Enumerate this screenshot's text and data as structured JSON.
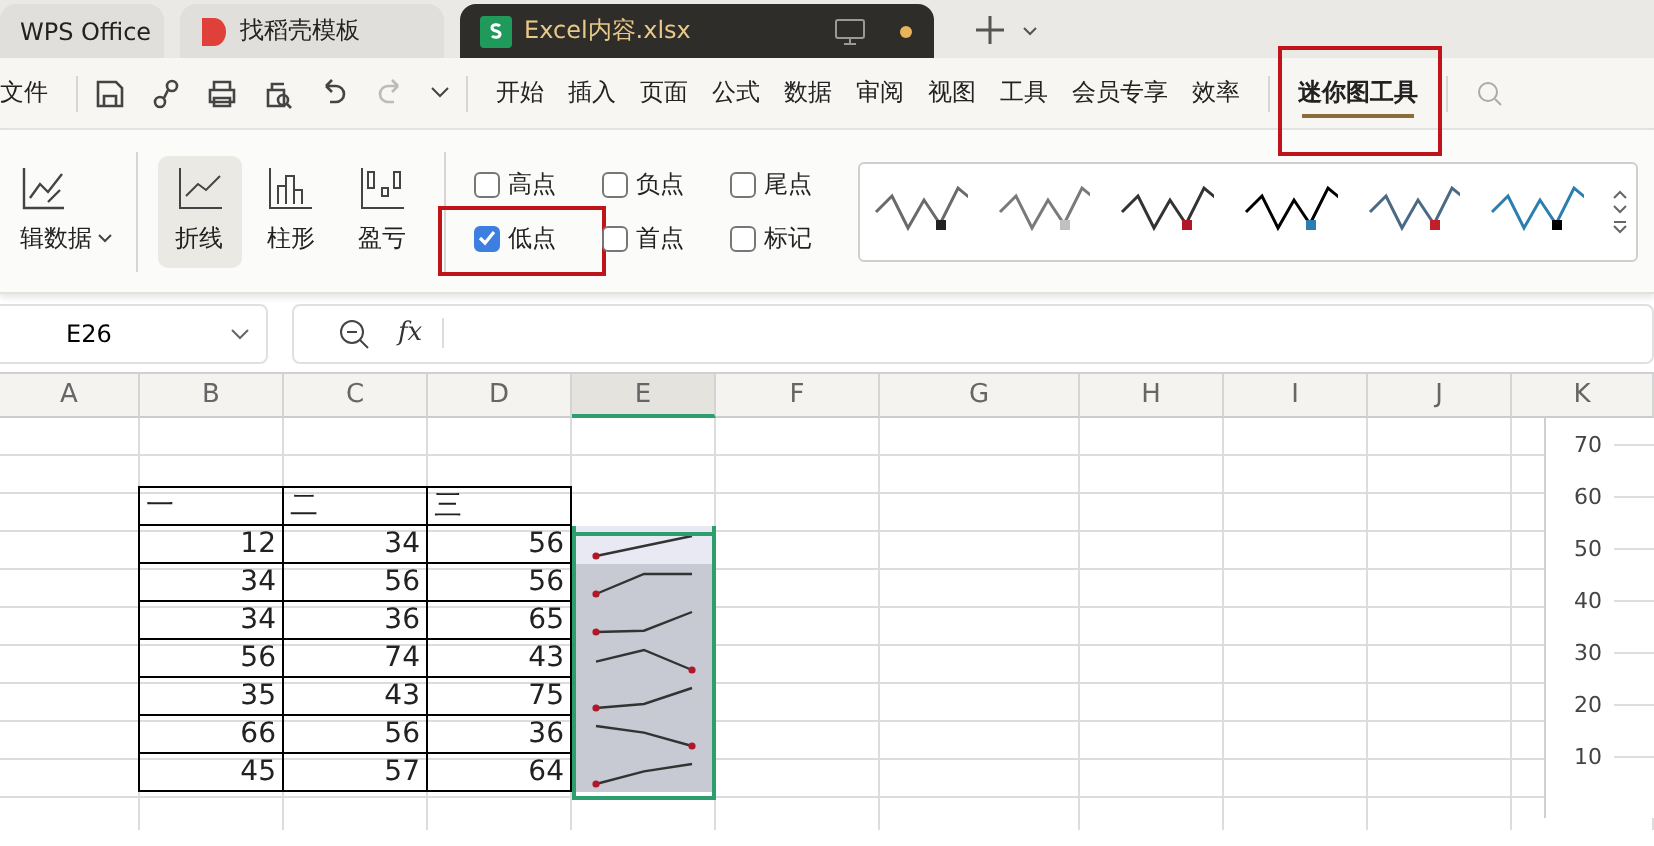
{
  "tabs": [
    {
      "label": "WPS Office",
      "kind": "home",
      "selected": false
    },
    {
      "label": "找稻壳模板",
      "kind": "docer",
      "selected": false
    },
    {
      "label": "Excel内容.xlsx",
      "kind": "sheet",
      "selected": true
    }
  ],
  "menu": {
    "file": "文件",
    "items": [
      {
        "label": "开始",
        "selected": false,
        "highlighted": false
      },
      {
        "label": "插入",
        "selected": false,
        "highlighted": false
      },
      {
        "label": "页面",
        "selected": false,
        "highlighted": false
      },
      {
        "label": "公式",
        "selected": false,
        "highlighted": false
      },
      {
        "label": "数据",
        "selected": false,
        "highlighted": false
      },
      {
        "label": "审阅",
        "selected": false,
        "highlighted": false
      },
      {
        "label": "视图",
        "selected": false,
        "highlighted": false
      },
      {
        "label": "工具",
        "selected": false,
        "highlighted": false
      },
      {
        "label": "会员专享",
        "selected": false,
        "highlighted": false
      },
      {
        "label": "效率",
        "selected": false,
        "highlighted": false
      },
      {
        "label": "迷你图工具",
        "selected": true,
        "highlighted": true
      }
    ]
  },
  "ribbon": {
    "edit_data": "辑数据",
    "types": [
      {
        "label": "折线",
        "kind": "line",
        "selected": true
      },
      {
        "label": "柱形",
        "kind": "column",
        "selected": false
      },
      {
        "label": "盈亏",
        "kind": "winloss",
        "selected": false
      }
    ],
    "options": [
      {
        "label": "高点",
        "checked": false,
        "highlighted": false
      },
      {
        "label": "负点",
        "checked": false,
        "highlighted": false
      },
      {
        "label": "尾点",
        "checked": false,
        "highlighted": false
      },
      {
        "label": "低点",
        "checked": true,
        "highlighted": true
      },
      {
        "label": "首点",
        "checked": false,
        "highlighted": false
      },
      {
        "label": "标记",
        "checked": false,
        "highlighted": false
      }
    ],
    "styles": [
      {
        "color": "#6a6a6a",
        "marker": {
          "color": "#222222"
        }
      },
      {
        "color": "#7a7a7a",
        "marker": {
          "color": "#c0c0c0"
        }
      },
      {
        "color": "#333333",
        "marker": {
          "color": "#b0182a"
        }
      },
      {
        "color": "#000000",
        "marker": {
          "color": "#2a7fb0"
        }
      },
      {
        "color": "#4a6a86",
        "marker": {
          "color": "#c0202a"
        }
      },
      {
        "color": "#2a7fb0",
        "marker": {
          "color": "#000000"
        }
      }
    ]
  },
  "formula_bar": {
    "name_box": "E26",
    "fx": "fx"
  },
  "sheet": {
    "columns": [
      {
        "label": "A",
        "selected": false
      },
      {
        "label": "B",
        "selected": false
      },
      {
        "label": "C",
        "selected": false
      },
      {
        "label": "D",
        "selected": false
      },
      {
        "label": "E",
        "selected": true
      },
      {
        "label": "F",
        "selected": false
      },
      {
        "label": "G",
        "selected": false
      },
      {
        "label": "H",
        "selected": false
      },
      {
        "label": "I",
        "selected": false
      },
      {
        "label": "J",
        "selected": false
      },
      {
        "label": "K",
        "selected": false
      }
    ],
    "header_row": [
      "一",
      "二",
      "三"
    ],
    "rows": [
      [
        "12",
        "34",
        "56"
      ],
      [
        "34",
        "56",
        "56"
      ],
      [
        "34",
        "36",
        "65"
      ],
      [
        "56",
        "74",
        "43"
      ],
      [
        "35",
        "43",
        "75"
      ],
      [
        "66",
        "56",
        "36"
      ],
      [
        "45",
        "57",
        "64"
      ]
    ],
    "chart_ticks": [
      "70",
      "60",
      "50",
      "40",
      "30",
      "20",
      "10"
    ]
  }
}
